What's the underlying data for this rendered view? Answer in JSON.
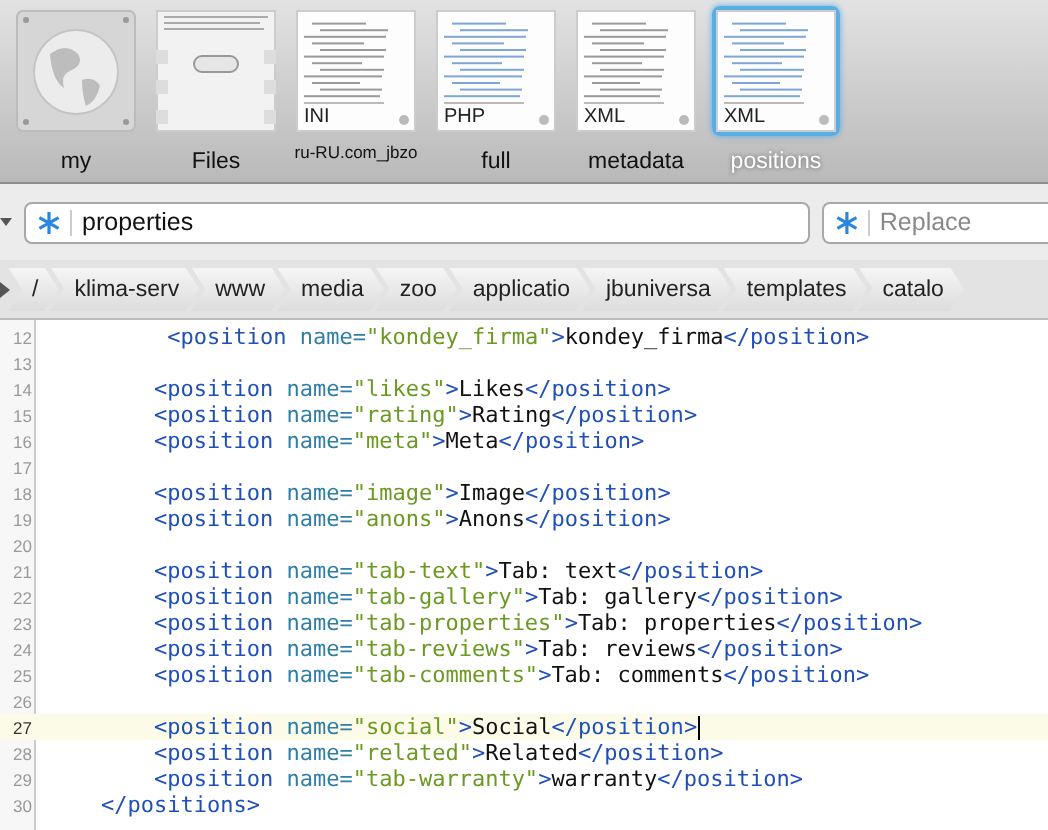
{
  "documents": [
    {
      "kind": "globe",
      "label": "my",
      "selected": false
    },
    {
      "kind": "files",
      "label": "Files",
      "selected": false
    },
    {
      "kind": "document",
      "badge": "INI",
      "label": "ru-RU.com_jbzo",
      "selected": false
    },
    {
      "kind": "document",
      "badge": "PHP",
      "label": "full",
      "selected": false
    },
    {
      "kind": "document",
      "badge": "XML",
      "label": "metadata",
      "selected": false
    },
    {
      "kind": "document",
      "badge": "XML",
      "label": "positions",
      "selected": true
    }
  ],
  "search": {
    "value": "properties"
  },
  "replace": {
    "placeholder": "Replace"
  },
  "path": [
    "/",
    "klima-serv",
    "www",
    "media",
    "zoo",
    "applicatio",
    "jbuniversa",
    "templates",
    "catalo"
  ],
  "lines": [
    {
      "number": "12",
      "code": "         <position name=\"kondey_firma\">kondey_firma</position>",
      "current": false
    },
    {
      "number": "13",
      "current": false
    },
    {
      "number": "14",
      "code": "        <position name=\"likes\">Likes</position>",
      "current": false
    },
    {
      "number": "15",
      "code": "        <position name=\"rating\">Rating</position>",
      "current": false
    },
    {
      "number": "16",
      "code": "        <position name=\"meta\">Meta</position>",
      "current": false
    },
    {
      "number": "17",
      "current": false
    },
    {
      "number": "18",
      "code": "        <position name=\"image\">Image</position>",
      "current": false
    },
    {
      "number": "19",
      "code": "        <position name=\"anons\">Anons</position>",
      "current": false
    },
    {
      "number": "20",
      "current": false
    },
    {
      "number": "21",
      "code": "        <position name=\"tab-text\">Tab: text</position>",
      "current": false
    },
    {
      "number": "22",
      "code": "        <position name=\"tab-gallery\">Tab: gallery</position>",
      "current": false
    },
    {
      "number": "23",
      "code": "        <position name=\"tab-properties\">Tab: properties</position>",
      "current": false
    },
    {
      "number": "24",
      "code": "        <position name=\"tab-reviews\">Tab: reviews</position>",
      "current": false
    },
    {
      "number": "25",
      "code": "        <position name=\"tab-comments\">Tab: comments</position>",
      "current": false
    },
    {
      "number": "26",
      "current": false
    },
    {
      "number": "27",
      "code": "        <position name=\"social\">Social</position>",
      "current": true
    },
    {
      "number": "28",
      "code": "        <position name=\"related\">Related</position>",
      "current": false
    },
    {
      "number": "29",
      "code": "        <position name=\"tab-warranty\">warranty</position>",
      "current": false
    },
    {
      "number": "30",
      "code": "    </positions>",
      "current": false
    }
  ]
}
